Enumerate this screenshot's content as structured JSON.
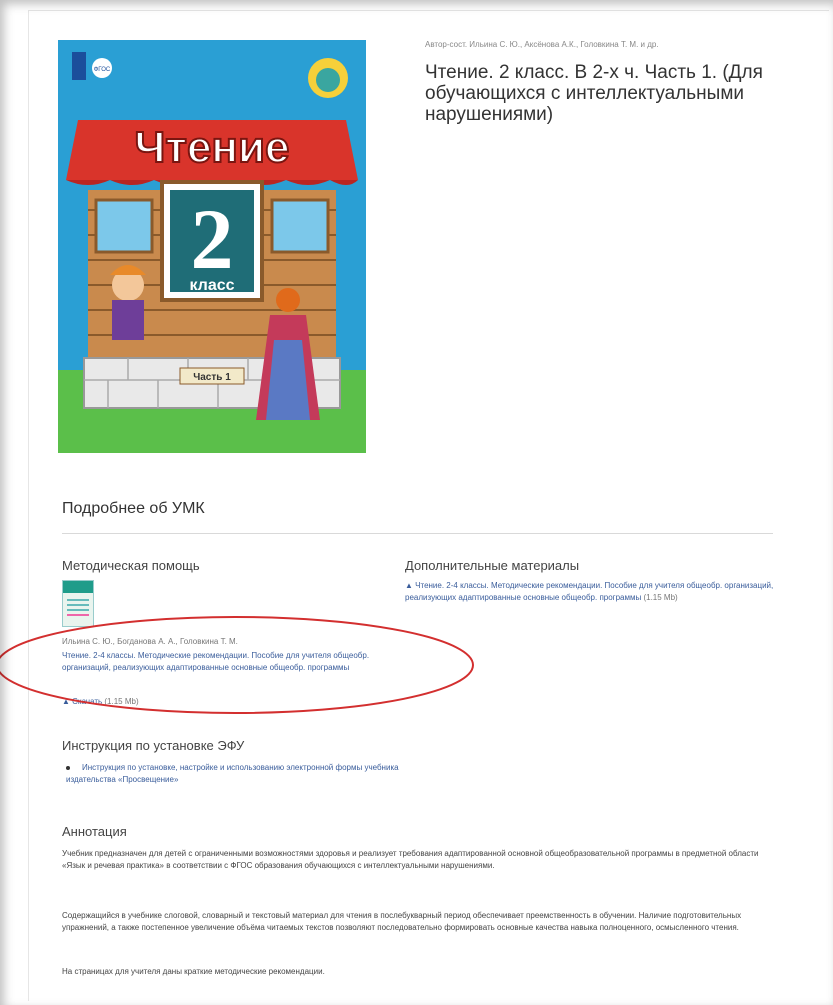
{
  "book": {
    "authors": "Автор-сост. Ильина С. Ю., Аксёнова А.К., Головкина Т. М. и др.",
    "title": "Чтение. 2 класс. В 2-х ч. Часть 1. (Для обучающихся с интеллектуальными нарушениями)",
    "cover": {
      "title": "Чтение",
      "grade_number": "2",
      "grade_word": "класс",
      "part": "Часть 1",
      "publisher_badge": "ФГОС"
    }
  },
  "details": {
    "heading": "Подробнее об УМК"
  },
  "methodical": {
    "heading": "Методическая помощь",
    "authors": "Ильина С. Ю., Богданова А. А., Головкина Т. М.",
    "title": "Чтение. 2-4 классы. Методические рекомендации. Пособие для учителя общеобр. организаций, реализующих адаптированные основные общеобр. программы",
    "download_label": "Скачать",
    "size": "(1.15 Mb)"
  },
  "additional": {
    "heading": "Дополнительные материалы",
    "item": "Чтение. 2-4 классы. Методические рекомендации. Пособие для учителя общеобр. организаций, реализующих адаптированные основные общеобр. программы",
    "size": "(1.15 Mb)"
  },
  "install": {
    "heading": "Инструкция по установке ЭФУ",
    "item": "Инструкция по установке, настройке и использованию электронной формы учебника издательства «Просвещение»"
  },
  "annotation": {
    "heading": "Аннотация",
    "p1": "Учебник предназначен для детей с ограниченными возможностями здоровья и реализует требования адаптированной основной общеобразовательной программы в предметной области «Язык и речевая практика» в соответствии с ФГОС образования обучающихся с интеллектуальными нарушениями.",
    "p2": "Содержащийся в учебнике слоговой, словарный и текстовый материал для чтения в послебукварный период обеспечивает преемственность в обучении. Наличие подготовительных упражнений, а также постепенное увеличение объёма читаемых текстов позволяют последовательно формировать основные качества навыка полноценного, осмысленного чтения.",
    "p3": "На страницах для учителя даны краткие методические рекомендации."
  },
  "colors": {
    "link": "#3a5d9b",
    "annotation_ellipse": "#d32f2f",
    "cover_blue": "#2a9fd4",
    "cover_roof": "#d9342b"
  }
}
